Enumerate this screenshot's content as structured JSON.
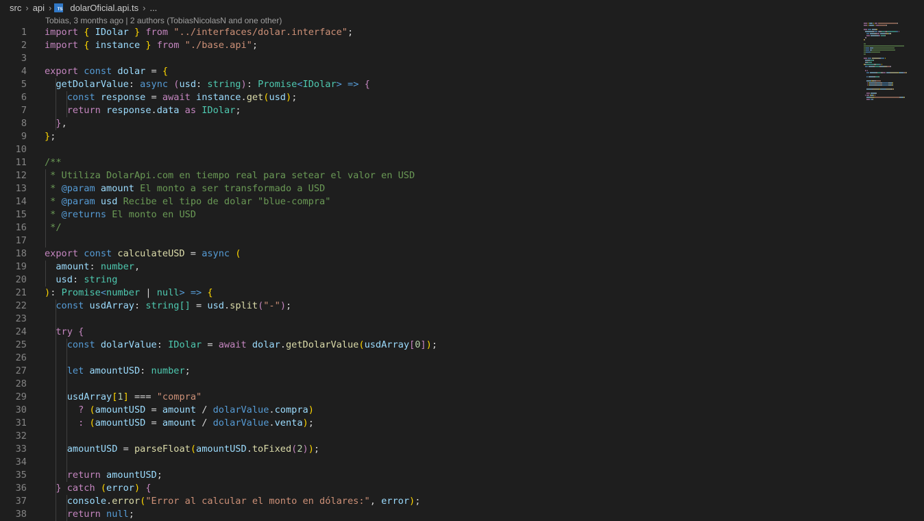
{
  "breadcrumb": {
    "segments": [
      "src",
      "api"
    ],
    "file_icon": "typescript-file-icon",
    "file_icon_text": "TS",
    "file_name": "dolarOficial.api.ts",
    "more": "..."
  },
  "blame": "Tobias, 3 months ago | 2 authors (TobiasNicolasN and one other)",
  "colors": {
    "background": "#1e1e1e",
    "keyword_blue": "#569cd6",
    "control_purple": "#c586c0",
    "type_teal": "#4ec9b0",
    "variable": "#9cdcfe",
    "function": "#dcdcaa",
    "string": "#ce9178",
    "comment": "#6a9955",
    "number": "#b5cea8"
  },
  "editor": {
    "lines": [
      {
        "n": "1",
        "tokens": [
          [
            "import",
            "p"
          ],
          [
            " ",
            ""
          ],
          [
            "{",
            "y"
          ],
          [
            " ",
            ""
          ],
          [
            "IDolar",
            "v"
          ],
          [
            " ",
            ""
          ],
          [
            "}",
            "y"
          ],
          [
            " ",
            ""
          ],
          [
            "from",
            "p"
          ],
          [
            " ",
            ""
          ],
          [
            "\"../interfaces/dolar.interface\"",
            "s"
          ],
          [
            ";",
            ""
          ]
        ]
      },
      {
        "n": "2",
        "tokens": [
          [
            "import",
            "p"
          ],
          [
            " ",
            ""
          ],
          [
            "{",
            "y"
          ],
          [
            " ",
            ""
          ],
          [
            "instance",
            "v"
          ],
          [
            " ",
            ""
          ],
          [
            "}",
            "y"
          ],
          [
            " ",
            ""
          ],
          [
            "from",
            "p"
          ],
          [
            " ",
            ""
          ],
          [
            "\"./base.api\"",
            "s"
          ],
          [
            ";",
            ""
          ]
        ]
      },
      {
        "n": "3",
        "tokens": []
      },
      {
        "n": "4",
        "tokens": [
          [
            "export",
            "p"
          ],
          [
            " ",
            ""
          ],
          [
            "const",
            "b"
          ],
          [
            " ",
            ""
          ],
          [
            "dolar",
            "v"
          ],
          [
            " = ",
            ""
          ],
          [
            "{",
            "y"
          ]
        ]
      },
      {
        "n": "5",
        "tokens": [
          [
            "  ",
            ""
          ],
          [
            "getDolarValue",
            "v"
          ],
          [
            ": ",
            ""
          ],
          [
            "async",
            "b"
          ],
          [
            " ",
            ""
          ],
          [
            "(",
            "p"
          ],
          [
            "usd",
            "v"
          ],
          [
            ": ",
            ""
          ],
          [
            "string",
            "t"
          ],
          [
            ")",
            "p"
          ],
          [
            ": ",
            ""
          ],
          [
            "Promise",
            "t"
          ],
          [
            "<",
            "b"
          ],
          [
            "IDolar",
            "t"
          ],
          [
            ">",
            "b"
          ],
          [
            " ",
            ""
          ],
          [
            "=>",
            "b"
          ],
          [
            " ",
            ""
          ],
          [
            "{",
            "p"
          ]
        ]
      },
      {
        "n": "6",
        "tokens": [
          [
            "    ",
            ""
          ],
          [
            "const",
            "b"
          ],
          [
            " ",
            ""
          ],
          [
            "response",
            "v"
          ],
          [
            " = ",
            ""
          ],
          [
            "await",
            "p"
          ],
          [
            " ",
            ""
          ],
          [
            "instance",
            "v"
          ],
          [
            ".",
            ""
          ],
          [
            "get",
            "f"
          ],
          [
            "(",
            "y"
          ],
          [
            "usd",
            "v"
          ],
          [
            ")",
            "y"
          ],
          [
            ";",
            ""
          ]
        ]
      },
      {
        "n": "7",
        "tokens": [
          [
            "    ",
            ""
          ],
          [
            "return",
            "p"
          ],
          [
            " ",
            ""
          ],
          [
            "response",
            "v"
          ],
          [
            ".",
            ""
          ],
          [
            "data",
            "v"
          ],
          [
            " ",
            ""
          ],
          [
            "as",
            "p"
          ],
          [
            " ",
            ""
          ],
          [
            "IDolar",
            "t"
          ],
          [
            ";",
            ""
          ]
        ]
      },
      {
        "n": "8",
        "tokens": [
          [
            "  ",
            ""
          ],
          [
            "}",
            "p"
          ],
          [
            ",",
            ""
          ]
        ]
      },
      {
        "n": "9",
        "tokens": [
          [
            "}",
            "y"
          ],
          [
            ";",
            ""
          ]
        ]
      },
      {
        "n": "10",
        "tokens": []
      },
      {
        "n": "11",
        "tokens": [
          [
            "/**",
            "c"
          ]
        ]
      },
      {
        "n": "12",
        "tokens": [
          [
            " * Utiliza DolarApi.com en tiempo real para setear el valor en USD",
            "c"
          ]
        ]
      },
      {
        "n": "13",
        "tokens": [
          [
            " * ",
            "c"
          ],
          [
            "@param",
            "b"
          ],
          [
            " ",
            "c"
          ],
          [
            "amount",
            "v"
          ],
          [
            " El monto a ser transformado a USD",
            "c"
          ]
        ]
      },
      {
        "n": "14",
        "tokens": [
          [
            " * ",
            "c"
          ],
          [
            "@param",
            "b"
          ],
          [
            " ",
            "c"
          ],
          [
            "usd",
            "v"
          ],
          [
            " Recibe el tipo de dolar \"blue-compra\"",
            "c"
          ]
        ]
      },
      {
        "n": "15",
        "tokens": [
          [
            " * ",
            "c"
          ],
          [
            "@returns",
            "b"
          ],
          [
            " El monto en USD",
            "c"
          ]
        ]
      },
      {
        "n": "16",
        "tokens": [
          [
            " */",
            "c"
          ]
        ]
      },
      {
        "n": "17",
        "tokens": []
      },
      {
        "n": "18",
        "tokens": [
          [
            "export",
            "p"
          ],
          [
            " ",
            ""
          ],
          [
            "const",
            "b"
          ],
          [
            " ",
            ""
          ],
          [
            "calculateUSD",
            "f"
          ],
          [
            " = ",
            ""
          ],
          [
            "async",
            "b"
          ],
          [
            " ",
            ""
          ],
          [
            "(",
            "y"
          ]
        ]
      },
      {
        "n": "19",
        "tokens": [
          [
            "  ",
            ""
          ],
          [
            "amount",
            "v"
          ],
          [
            ": ",
            ""
          ],
          [
            "number",
            "t"
          ],
          [
            ",",
            ""
          ]
        ]
      },
      {
        "n": "20",
        "tokens": [
          [
            "  ",
            ""
          ],
          [
            "usd",
            "v"
          ],
          [
            ": ",
            ""
          ],
          [
            "string",
            "t"
          ]
        ]
      },
      {
        "n": "21",
        "tokens": [
          [
            ")",
            "y"
          ],
          [
            ": ",
            ""
          ],
          [
            "Promise",
            "t"
          ],
          [
            "<",
            "b"
          ],
          [
            "number",
            "t"
          ],
          [
            " | ",
            ""
          ],
          [
            "null",
            "t"
          ],
          [
            ">",
            "b"
          ],
          [
            " ",
            ""
          ],
          [
            "=>",
            "b"
          ],
          [
            " ",
            ""
          ],
          [
            "{",
            "y"
          ]
        ]
      },
      {
        "n": "22",
        "tokens": [
          [
            "  ",
            ""
          ],
          [
            "const",
            "b"
          ],
          [
            " ",
            ""
          ],
          [
            "usdArray",
            "v"
          ],
          [
            ": ",
            ""
          ],
          [
            "string",
            "t"
          ],
          [
            "[]",
            "t"
          ],
          [
            " = ",
            ""
          ],
          [
            "usd",
            "v"
          ],
          [
            ".",
            ""
          ],
          [
            "split",
            "f"
          ],
          [
            "(",
            "p"
          ],
          [
            "\"-\"",
            "s"
          ],
          [
            ")",
            "p"
          ],
          [
            ";",
            ""
          ]
        ]
      },
      {
        "n": "23",
        "tokens": []
      },
      {
        "n": "24",
        "tokens": [
          [
            "  ",
            ""
          ],
          [
            "try",
            "p"
          ],
          [
            " ",
            ""
          ],
          [
            "{",
            "p"
          ]
        ]
      },
      {
        "n": "25",
        "tokens": [
          [
            "    ",
            ""
          ],
          [
            "const",
            "b"
          ],
          [
            " ",
            ""
          ],
          [
            "dolarValue",
            "v"
          ],
          [
            ": ",
            ""
          ],
          [
            "IDolar",
            "t"
          ],
          [
            " = ",
            ""
          ],
          [
            "await",
            "p"
          ],
          [
            " ",
            ""
          ],
          [
            "dolar",
            "v"
          ],
          [
            ".",
            ""
          ],
          [
            "getDolarValue",
            "f"
          ],
          [
            "(",
            "y"
          ],
          [
            "usdArray",
            "v"
          ],
          [
            "[",
            "p"
          ],
          [
            "0",
            "n"
          ],
          [
            "]",
            "p"
          ],
          [
            ")",
            "y"
          ],
          [
            ";",
            ""
          ]
        ]
      },
      {
        "n": "26",
        "tokens": []
      },
      {
        "n": "27",
        "tokens": [
          [
            "    ",
            ""
          ],
          [
            "let",
            "b"
          ],
          [
            " ",
            ""
          ],
          [
            "amountUSD",
            "v"
          ],
          [
            ": ",
            ""
          ],
          [
            "number",
            "t"
          ],
          [
            ";",
            ""
          ]
        ]
      },
      {
        "n": "28",
        "tokens": []
      },
      {
        "n": "29",
        "tokens": [
          [
            "    ",
            ""
          ],
          [
            "usdArray",
            "v"
          ],
          [
            "[",
            "y"
          ],
          [
            "1",
            "n"
          ],
          [
            "]",
            "y"
          ],
          [
            " === ",
            ""
          ],
          [
            "\"compra\"",
            "s"
          ]
        ]
      },
      {
        "n": "30",
        "tokens": [
          [
            "      ",
            ""
          ],
          [
            "?",
            "p"
          ],
          [
            " ",
            ""
          ],
          [
            "(",
            "y"
          ],
          [
            "amountUSD",
            "v"
          ],
          [
            " = ",
            ""
          ],
          [
            "amount",
            "v"
          ],
          [
            " / ",
            ""
          ],
          [
            "dolarValue",
            "b"
          ],
          [
            ".",
            ""
          ],
          [
            "compra",
            "v"
          ],
          [
            ")",
            "y"
          ]
        ]
      },
      {
        "n": "31",
        "tokens": [
          [
            "      ",
            ""
          ],
          [
            ":",
            "p"
          ],
          [
            " ",
            ""
          ],
          [
            "(",
            "y"
          ],
          [
            "amountUSD",
            "v"
          ],
          [
            " = ",
            ""
          ],
          [
            "amount",
            "v"
          ],
          [
            " / ",
            ""
          ],
          [
            "dolarValue",
            "b"
          ],
          [
            ".",
            ""
          ],
          [
            "venta",
            "v"
          ],
          [
            ")",
            "y"
          ],
          [
            ";",
            ""
          ]
        ]
      },
      {
        "n": "32",
        "tokens": []
      },
      {
        "n": "33",
        "tokens": [
          [
            "    ",
            ""
          ],
          [
            "amountUSD",
            "v"
          ],
          [
            " = ",
            ""
          ],
          [
            "parseFloat",
            "f"
          ],
          [
            "(",
            "y"
          ],
          [
            "amountUSD",
            "v"
          ],
          [
            ".",
            ""
          ],
          [
            "toFixed",
            "f"
          ],
          [
            "(",
            "p"
          ],
          [
            "2",
            "n"
          ],
          [
            ")",
            "p"
          ],
          [
            ")",
            "y"
          ],
          [
            ";",
            ""
          ]
        ]
      },
      {
        "n": "34",
        "tokens": []
      },
      {
        "n": "35",
        "tokens": [
          [
            "    ",
            ""
          ],
          [
            "return",
            "p"
          ],
          [
            " ",
            ""
          ],
          [
            "amountUSD",
            "v"
          ],
          [
            ";",
            ""
          ]
        ]
      },
      {
        "n": "36",
        "tokens": [
          [
            "  ",
            ""
          ],
          [
            "}",
            "p"
          ],
          [
            " ",
            ""
          ],
          [
            "catch",
            "p"
          ],
          [
            " ",
            ""
          ],
          [
            "(",
            "y"
          ],
          [
            "error",
            "v"
          ],
          [
            ")",
            "y"
          ],
          [
            " ",
            ""
          ],
          [
            "{",
            "p"
          ]
        ]
      },
      {
        "n": "37",
        "tokens": [
          [
            "    ",
            ""
          ],
          [
            "console",
            "v"
          ],
          [
            ".",
            ""
          ],
          [
            "error",
            "f"
          ],
          [
            "(",
            "y"
          ],
          [
            "\"Error al calcular el monto en dólares:\"",
            "s"
          ],
          [
            ", ",
            ""
          ],
          [
            "error",
            "v"
          ],
          [
            ")",
            "y"
          ],
          [
            ";",
            ""
          ]
        ]
      },
      {
        "n": "38",
        "tokens": [
          [
            "    ",
            ""
          ],
          [
            "return",
            "p"
          ],
          [
            " ",
            ""
          ],
          [
            "null",
            "b"
          ],
          [
            ";",
            ""
          ]
        ]
      }
    ]
  }
}
